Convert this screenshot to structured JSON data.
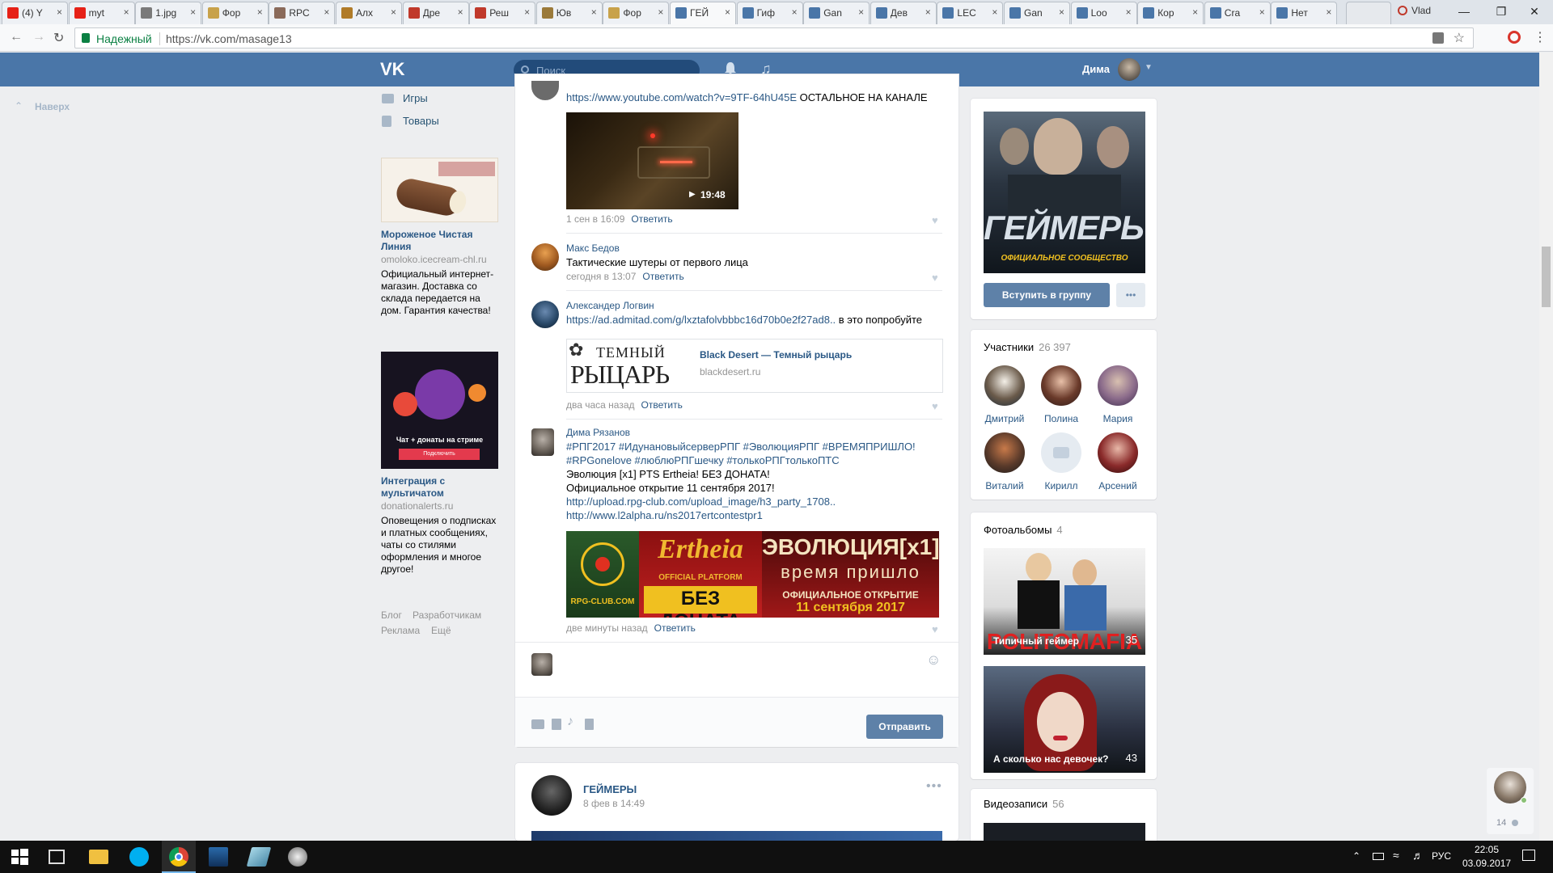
{
  "browser": {
    "tabs": [
      {
        "title": "(4) Y",
        "color": "#e62117"
      },
      {
        "title": "myt",
        "color": "#e62117"
      },
      {
        "title": "1.jpg",
        "color": "#7a7a7a"
      },
      {
        "title": "Фор",
        "color": "#c8a24a"
      },
      {
        "title": "RPC",
        "color": "#8a6a5a"
      },
      {
        "title": "Алх",
        "color": "#b07b28"
      },
      {
        "title": "Дре",
        "color": "#c0392b"
      },
      {
        "title": "Реш",
        "color": "#c0392b"
      },
      {
        "title": "Юв",
        "color": "#9b7a3a"
      },
      {
        "title": "Фор",
        "color": "#c8a24a"
      },
      {
        "title": "ГЕЙ",
        "color": "#4a76a8"
      },
      {
        "title": "Гиф",
        "color": "#4a76a8"
      },
      {
        "title": "Gan",
        "color": "#4a76a8"
      },
      {
        "title": "Дев",
        "color": "#4a76a8"
      },
      {
        "title": "LEC",
        "color": "#4a76a8"
      },
      {
        "title": "Gan",
        "color": "#4a76a8"
      },
      {
        "title": "Loo",
        "color": "#4a76a8"
      },
      {
        "title": "Кор",
        "color": "#4a76a8"
      },
      {
        "title": "Cra",
        "color": "#4a76a8"
      },
      {
        "title": "Нет",
        "color": "#4a76a8"
      }
    ],
    "profile_label": "Vlad",
    "secure_label": "Надежный",
    "url": "https://vk.com/masage13"
  },
  "vk": {
    "logo": "VK",
    "search_placeholder": "Поиск",
    "user_name": "Дима"
  },
  "left": {
    "back_top": "Наверх",
    "nav": [
      {
        "label": "Игры",
        "icon": "gamepad-icon"
      },
      {
        "label": "Товары",
        "icon": "bag-icon"
      }
    ],
    "ads": [
      {
        "title": "Мороженое Чистая Линия",
        "domain": "omoloko.icecream-chl.ru",
        "desc": "Официальный интернет-магазин. Доставка со склада передается на дом. Гарантия качества!"
      },
      {
        "title": "Интеграция с мультичатом",
        "domain": "donationalerts.ru",
        "desc": "Оповещения о подписках и платных сообщениях, чаты со стилями оформления и многое другое!",
        "banner_text": "Чат + донаты на стриме",
        "banner_btn": "Подключить"
      }
    ],
    "footer": [
      "Блог",
      "Разработчикам",
      "Реклама",
      "Ещё"
    ]
  },
  "feed": {
    "comment1": {
      "link": "https://www.youtube.com/watch?v=9TF-64hU45E",
      "text": " ОСТАЛЬНОЕ НА КАНАЛЕ",
      "video_duration": "19:48",
      "time": "1 сен в 16:09",
      "reply": "Ответить"
    },
    "comment2": {
      "author": "Макс Бедов",
      "text": "Тактические шутеры от первого лица",
      "time": "сегодня в 13:07",
      "reply": "Ответить"
    },
    "comment3": {
      "author": "Александер Логвин",
      "link": "https://ad.admitad.com/g/lxztafolvbbbc16d70b0e2f27ad8..",
      "text": " в это попробуйте",
      "snippet_title": "Black Desert — Темный рыцарь",
      "snippet_domain": "blackdesert.ru",
      "snippet_img_top": "ТЕМНЫЙ",
      "snippet_img_bottom": "РЫЦАРЬ",
      "time": "два часа назад",
      "reply": "Ответить"
    },
    "comment4": {
      "author": "Дима Рязанов",
      "lines": [
        "#РПГ2017 #ИдунановыйсерверРПГ #ЭволюцияРПГ #ВРЕМЯПРИШЛО!",
        "#RPGonelove #люблюРПГшечку #толькоРПГтолькоПТС",
        "Эволюция [x1] PTS Ertheia! БЕЗ ДОНАТА!",
        "Официальное открытие 11 сентября 2017!"
      ],
      "links": [
        "http://upload.rpg-club.com/upload_image/h3_party_1708..",
        "http://www.l2alpha.ru/ns2017ertcontestpr1"
      ],
      "banner": {
        "left": "RPG-CLUB.COM",
        "mid_top": "Ertheia",
        "mid_sub": "OFFICIAL PLATFORM",
        "mid_bottom": "БЕЗ ДОНАТА",
        "right_top": "ЭВОЛЮЦИЯ[x1]",
        "right_mid": "время пришло",
        "right_sub": "ОФИЦИАЛЬНОЕ ОТКРЫТИЕ",
        "right_date": "11 сентября 2017"
      },
      "time": "две минуты назад",
      "reply": "Ответить"
    },
    "composer": {
      "send_label": "Отправить"
    },
    "next_post": {
      "author": "ГЕЙМЕРЫ",
      "time": "8 фев в 14:49"
    }
  },
  "right": {
    "cover_text": "ГЕЙМЕРЫ",
    "cover_sub": "ОФИЦИАЛЬНОЕ СООБЩЕСТВО",
    "join_label": "Вступить в группу",
    "members_title": "Участники",
    "members_count": "26 397",
    "members": [
      "Дмитрий",
      "Полина",
      "Мария",
      "Виталий",
      "Кирилл",
      "Арсений"
    ],
    "albums_title": "Фотоальбомы",
    "albums_count": "4",
    "albums": [
      {
        "title": "Типичный геймер",
        "count": "35",
        "overlay": "POLITOMAFIA"
      },
      {
        "title": "А сколько нас девочек?",
        "count": "43"
      }
    ],
    "videos_title": "Видеозаписи",
    "videos_count": "56",
    "chat_count": "14"
  },
  "taskbar": {
    "lang": "РУС",
    "time": "22:05",
    "date": "03.09.2017"
  }
}
